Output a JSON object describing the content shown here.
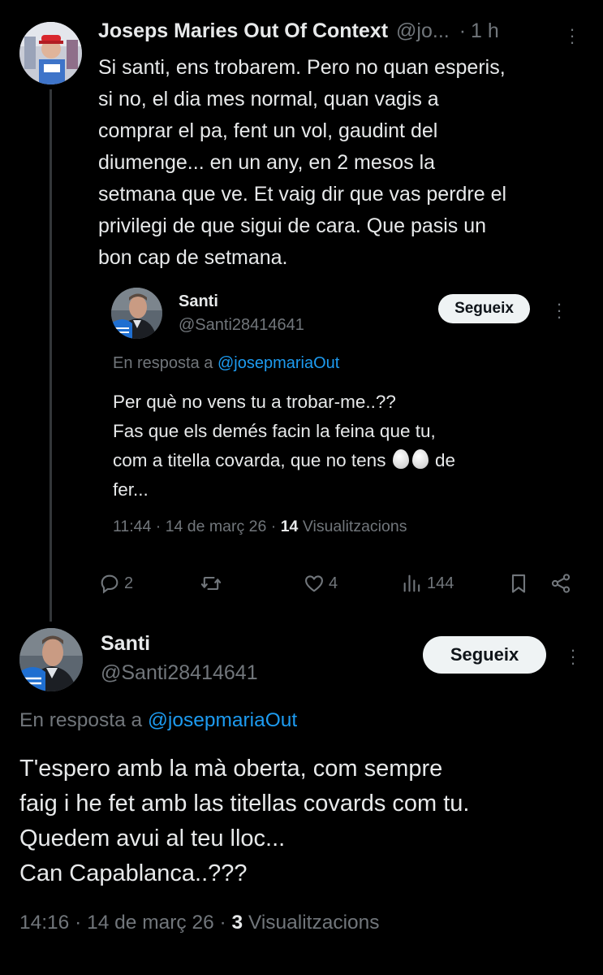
{
  "tweet1": {
    "author_name": "Joseps Maries Out Of Context",
    "handle": "@jo...",
    "time": "1 h",
    "body_lines": [
      "Si santi, ens trobarem. Pero no quan esperis,",
      "si no, el dia mes normal, quan vagis a",
      "comprar el pa, fent un vol, gaudint del",
      "diumenge... en un any, en 2 mesos la",
      "setmana que ve. Et vaig dir que vas perdre el",
      "privilegi de que sigui de cara. Que pasis un",
      "bon cap de setmana."
    ]
  },
  "quoted": {
    "author_name": "Santi",
    "handle": "@Santi28414641",
    "follow_label": "Segueix",
    "reply_prefix": "En resposta a",
    "reply_to": "@josepmariaOut",
    "line1": "Per què no vens tu a trobar-me..??",
    "line2": "Fas que els demés facin la feina que tu,",
    "line3_before": "com a titella covarda, que no tens",
    "line3_after": "de",
    "line4": "fer...",
    "time": "11:44",
    "date": "14 de març 26",
    "views_count": "14",
    "views_label": "Visualitzacions"
  },
  "actions": {
    "replies": "2",
    "retweets": "",
    "likes": "4",
    "views": "144"
  },
  "tweet2": {
    "author_name": "Santi",
    "handle": "@Santi28414641",
    "follow_label": "Segueix",
    "reply_prefix": "En resposta a",
    "reply_to": "@josepmariaOut",
    "body_lines": [
      "T'espero amb la mà oberta, com sempre",
      "faig i he fet amb las titellas covards com tu.",
      "Quedem avui al teu lloc...",
      "Can Capablanca..???"
    ],
    "time": "14:16",
    "date": "14 de març 26",
    "views_count": "3",
    "views_label": "Visualitzacions"
  },
  "icons": {
    "reply": "comment-bubble-icon",
    "retweet": "retweet-icon",
    "like": "heart-icon",
    "views": "bar-chart-icon",
    "bookmark": "bookmark-icon",
    "share": "share-icon"
  },
  "colors": {
    "background": "#000000",
    "text_primary": "#e7e9ea",
    "text_secondary": "#71767b",
    "mention": "#1d9bf0",
    "follow_button_bg": "#eff3f4"
  }
}
